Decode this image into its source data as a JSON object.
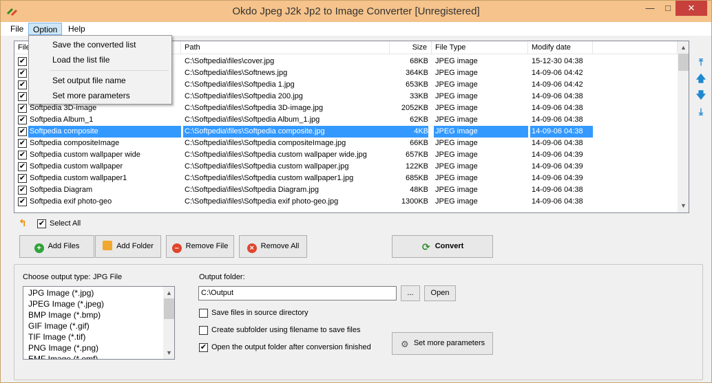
{
  "window": {
    "title": "Okdo Jpeg J2k Jp2 to Image Converter [Unregistered]"
  },
  "menu": {
    "file": "File",
    "option": "Option",
    "help": "Help",
    "option_items": [
      "Save the converted list",
      "Load the list file",
      "Set output file name",
      "Set more parameters"
    ]
  },
  "columns": [
    "File",
    "Path",
    "Size",
    "File Type",
    "Modify date"
  ],
  "rows": [
    {
      "name": "",
      "path": "C:\\Softpedia\\files\\cover.jpg",
      "size": "68KB",
      "type": "JPEG image",
      "date": "15-12-30 04:38"
    },
    {
      "name": "",
      "path": "C:\\Softpedia\\files\\Softnews.jpg",
      "size": "364KB",
      "type": "JPEG image",
      "date": "14-09-06 04:42"
    },
    {
      "name": "",
      "path": "C:\\Softpedia\\files\\Softpedia 1.jpg",
      "size": "653KB",
      "type": "JPEG image",
      "date": "14-09-06 04:42"
    },
    {
      "name": "",
      "path": "C:\\Softpedia\\files\\Softpedia 200.jpg",
      "size": "33KB",
      "type": "JPEG image",
      "date": "14-09-06 04:38"
    },
    {
      "name": "Softpedia 3D-image",
      "path": "C:\\Softpedia\\files\\Softpedia 3D-image.jpg",
      "size": "2052KB",
      "type": "JPEG image",
      "date": "14-09-06 04:38"
    },
    {
      "name": "Softpedia Album_1",
      "path": "C:\\Softpedia\\files\\Softpedia Album_1.jpg",
      "size": "62KB",
      "type": "JPEG image",
      "date": "14-09-06 04:38"
    },
    {
      "name": "Softpedia composite",
      "path": "C:\\Softpedia\\files\\Softpedia composite.jpg",
      "size": "4KB",
      "type": "JPEG image",
      "date": "14-09-06 04:38"
    },
    {
      "name": "Softpedia compositeImage",
      "path": "C:\\Softpedia\\files\\Softpedia compositeImage.jpg",
      "size": "66KB",
      "type": "JPEG image",
      "date": "14-09-06 04:38"
    },
    {
      "name": "Softpedia custom wallpaper wide",
      "path": "C:\\Softpedia\\files\\Softpedia custom wallpaper wide.jpg",
      "size": "657KB",
      "type": "JPEG image",
      "date": "14-09-06 04:39"
    },
    {
      "name": "Softpedia custom wallpaper",
      "path": "C:\\Softpedia\\files\\Softpedia custom wallpaper.jpg",
      "size": "122KB",
      "type": "JPEG image",
      "date": "14-09-06 04:39"
    },
    {
      "name": "Softpedia custom wallpaper1",
      "path": "C:\\Softpedia\\files\\Softpedia custom wallpaper1.jpg",
      "size": "685KB",
      "type": "JPEG image",
      "date": "14-09-06 04:39"
    },
    {
      "name": "Softpedia Diagram",
      "path": "C:\\Softpedia\\files\\Softpedia Diagram.jpg",
      "size": "48KB",
      "type": "JPEG image",
      "date": "14-09-06 04:38"
    },
    {
      "name": "Softpedia exif photo-geo",
      "path": "C:\\Softpedia\\files\\Softpedia exif photo-geo.jpg",
      "size": "1300KB",
      "type": "JPEG image",
      "date": "14-09-06 04:38"
    }
  ],
  "select_all": "Select All",
  "buttons": {
    "add_files": "Add Files",
    "add_folder": "Add Folder",
    "remove_file": "Remove File",
    "remove_all": "Remove All",
    "convert": "Convert",
    "browse": "...",
    "open": "Open",
    "set_params": "Set more parameters"
  },
  "output": {
    "type_label": "Choose output type:",
    "type_value": "JPG File",
    "types": [
      "JPG Image (*.jpg)",
      "JPEG Image (*.jpeg)",
      "BMP Image (*.bmp)",
      "GIF Image (*.gif)",
      "TIF Image (*.tif)",
      "PNG Image (*.png)",
      "EMF Image (*.emf)"
    ],
    "folder_label": "Output folder:",
    "folder_value": "C:\\Output",
    "save_in_source": "Save files in source directory",
    "create_subfolder": "Create subfolder using filename to save files",
    "open_after": "Open the output folder after conversion finished"
  },
  "colors": {
    "titlebar": "#f5c38b",
    "selection": "#3399ff",
    "close": "#c7403c"
  }
}
